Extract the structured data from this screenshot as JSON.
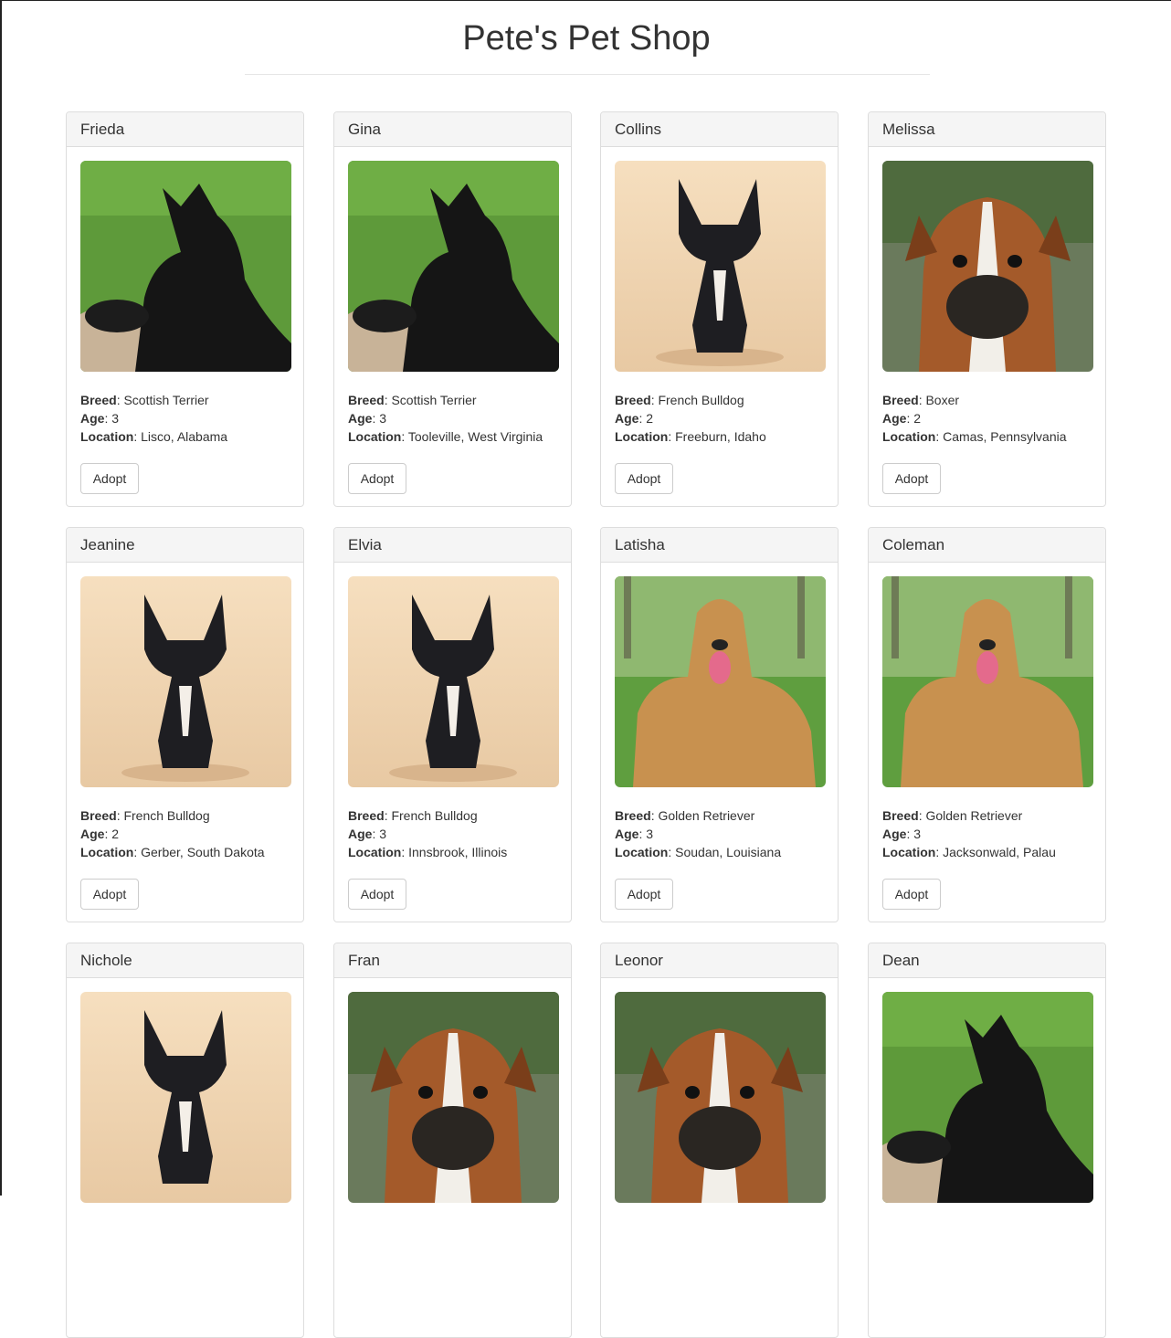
{
  "page_title": "Pete's Pet Shop",
  "labels": {
    "breed": "Breed",
    "age": "Age",
    "location": "Location",
    "adopt": "Adopt"
  },
  "pets": [
    {
      "name": "Frieda",
      "breed": "Scottish Terrier",
      "age": "3",
      "location": "Lisco, Alabama",
      "photo": "scottish-terrier-photo"
    },
    {
      "name": "Gina",
      "breed": "Scottish Terrier",
      "age": "3",
      "location": "Tooleville, West Virginia",
      "photo": "scottish-terrier-photo"
    },
    {
      "name": "Collins",
      "breed": "French Bulldog",
      "age": "2",
      "location": "Freeburn, Idaho",
      "photo": "french-bulldog-photo"
    },
    {
      "name": "Melissa",
      "breed": "Boxer",
      "age": "2",
      "location": "Camas, Pennsylvania",
      "photo": "boxer-photo"
    },
    {
      "name": "Jeanine",
      "breed": "French Bulldog",
      "age": "2",
      "location": "Gerber, South Dakota",
      "photo": "french-bulldog-photo"
    },
    {
      "name": "Elvia",
      "breed": "French Bulldog",
      "age": "3",
      "location": "Innsbrook, Illinois",
      "photo": "french-bulldog-photo"
    },
    {
      "name": "Latisha",
      "breed": "Golden Retriever",
      "age": "3",
      "location": "Soudan, Louisiana",
      "photo": "golden-retriever-photo"
    },
    {
      "name": "Coleman",
      "breed": "Golden Retriever",
      "age": "3",
      "location": "Jacksonwald, Palau",
      "photo": "golden-retriever-photo"
    },
    {
      "name": "Nichole",
      "photo": "french-bulldog-photo"
    },
    {
      "name": "Fran",
      "photo": "boxer-photo"
    },
    {
      "name": "Leonor",
      "photo": "boxer-photo"
    },
    {
      "name": "Dean",
      "photo": "scottish-terrier-photo"
    }
  ]
}
